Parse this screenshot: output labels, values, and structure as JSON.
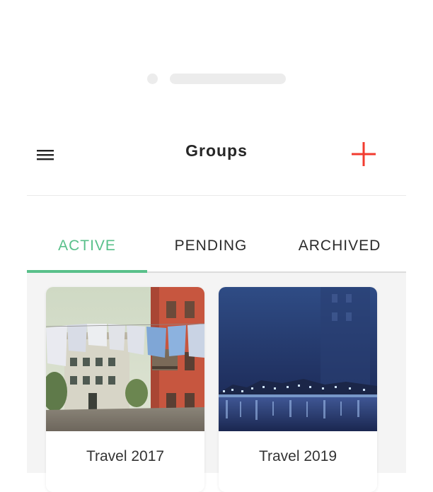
{
  "header": {
    "title": "Groups",
    "menu_icon": "hamburger-menu-icon",
    "add_icon": "plus-icon",
    "add_color": "#f23b2f"
  },
  "tabs": [
    {
      "label": "ACTIVE",
      "active": true
    },
    {
      "label": "PENDING",
      "active": false
    },
    {
      "label": "ARCHIVED",
      "active": false
    }
  ],
  "accent_color": "#59c08a",
  "groups": [
    {
      "name": "Travel 2017",
      "image": "street-with-laundry-photo"
    },
    {
      "name": "Travel 2019",
      "image": "night-harbor-photo"
    }
  ]
}
